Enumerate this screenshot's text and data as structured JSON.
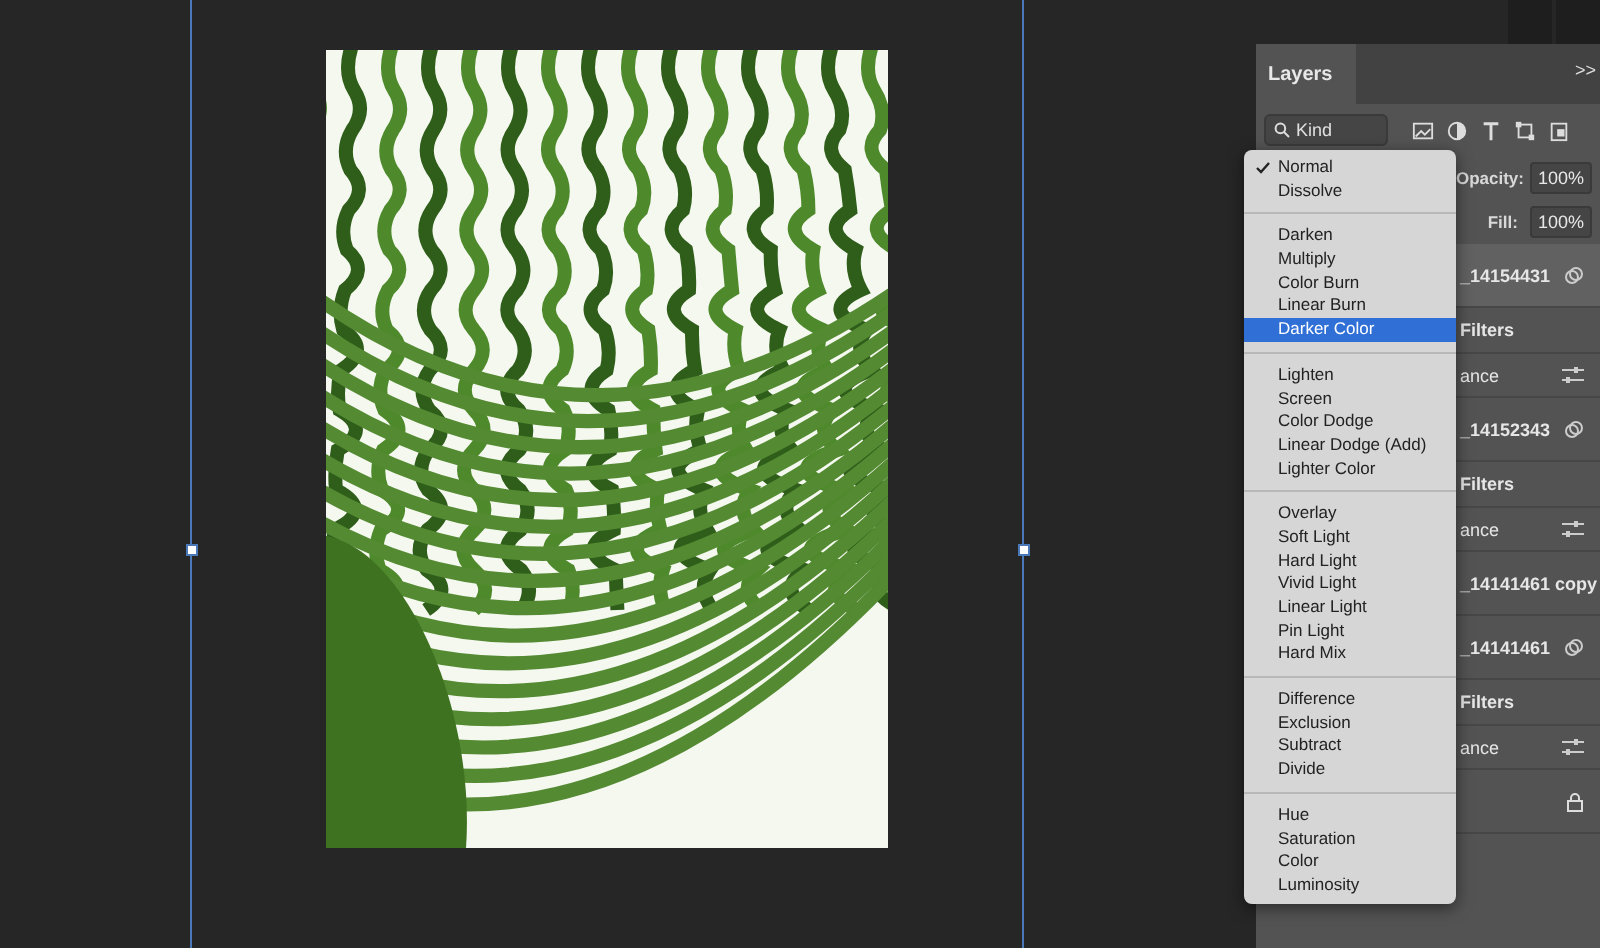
{
  "layers_panel": {
    "tab": "Layers",
    "collapse": ">>",
    "filter": {
      "value": "Kind"
    },
    "opacity": {
      "label": "Opacity:",
      "value": "100%"
    },
    "fill": {
      "label": "Fill:",
      "value": "100%"
    },
    "layers": [
      {
        "kind": "smart_object",
        "name": "_14154431",
        "selected": true
      },
      {
        "kind": "filters",
        "name": "Filters"
      },
      {
        "kind": "effect",
        "name": "ance"
      },
      {
        "kind": "smart_object",
        "name": "_14152343",
        "selected": false
      },
      {
        "kind": "filters",
        "name": "Filters"
      },
      {
        "kind": "effect",
        "name": "ance"
      },
      {
        "kind": "layer",
        "name": "_14141461 copy",
        "selected": false
      },
      {
        "kind": "smart_object",
        "name": "_14141461",
        "selected": false
      },
      {
        "kind": "filters",
        "name": "Filters"
      },
      {
        "kind": "effect",
        "name": "ance"
      },
      {
        "kind": "locked"
      }
    ]
  },
  "blend_menu": {
    "groups": [
      [
        {
          "label": "Normal",
          "checked": true,
          "selected": false
        },
        {
          "label": "Dissolve",
          "checked": false,
          "selected": false
        }
      ],
      [
        {
          "label": "Darken",
          "checked": false,
          "selected": false
        },
        {
          "label": "Multiply",
          "checked": false,
          "selected": false
        },
        {
          "label": "Color Burn",
          "checked": false,
          "selected": false
        },
        {
          "label": "Linear Burn",
          "checked": false,
          "selected": false
        },
        {
          "label": "Darker Color",
          "checked": false,
          "selected": true
        }
      ],
      [
        {
          "label": "Lighten",
          "checked": false,
          "selected": false
        },
        {
          "label": "Screen",
          "checked": false,
          "selected": false
        },
        {
          "label": "Color Dodge",
          "checked": false,
          "selected": false
        },
        {
          "label": "Linear Dodge (Add)",
          "checked": false,
          "selected": false
        },
        {
          "label": "Lighter Color",
          "checked": false,
          "selected": false
        }
      ],
      [
        {
          "label": "Overlay",
          "checked": false,
          "selected": false
        },
        {
          "label": "Soft Light",
          "checked": false,
          "selected": false
        },
        {
          "label": "Hard Light",
          "checked": false,
          "selected": false
        },
        {
          "label": "Vivid Light",
          "checked": false,
          "selected": false
        },
        {
          "label": "Linear Light",
          "checked": false,
          "selected": false
        },
        {
          "label": "Pin Light",
          "checked": false,
          "selected": false
        },
        {
          "label": "Hard Mix",
          "checked": false,
          "selected": false
        }
      ],
      [
        {
          "label": "Difference",
          "checked": false,
          "selected": false
        },
        {
          "label": "Exclusion",
          "checked": false,
          "selected": false
        },
        {
          "label": "Subtract",
          "checked": false,
          "selected": false
        },
        {
          "label": "Divide",
          "checked": false,
          "selected": false
        }
      ],
      [
        {
          "label": "Hue",
          "checked": false,
          "selected": false
        },
        {
          "label": "Saturation",
          "checked": false,
          "selected": false
        },
        {
          "label": "Color",
          "checked": false,
          "selected": false
        },
        {
          "label": "Luminosity",
          "checked": false,
          "selected": false
        }
      ]
    ]
  }
}
